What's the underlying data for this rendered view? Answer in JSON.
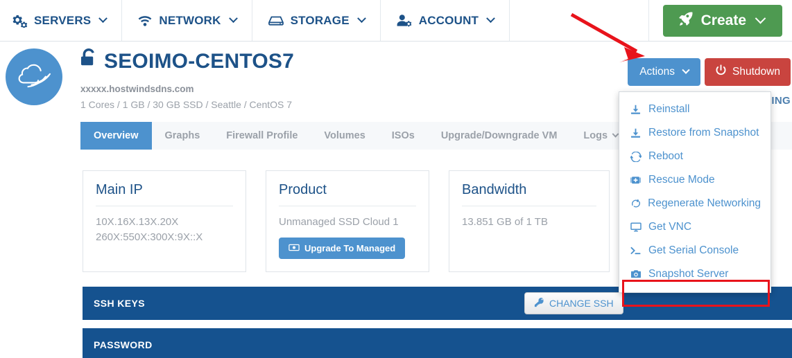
{
  "topnav": {
    "items": [
      {
        "label": "SERVERS",
        "icon": "gears-icon",
        "caret": true
      },
      {
        "label": "NETWORK",
        "icon": "wifi-icon",
        "caret": true
      },
      {
        "label": "STORAGE",
        "icon": "storage-icon",
        "caret": true
      },
      {
        "label": "ACCOUNT",
        "icon": "user-gear-icon",
        "caret": true
      }
    ],
    "create_label": "Create",
    "create_icon": "rocket-icon",
    "create_color": "#4e9a51"
  },
  "header": {
    "avatar_icon": "hostwinds-cloud-logo",
    "avatar_color": "#4d92ce",
    "lock_icon": "unlock-icon",
    "title": "SEOIMO-CENTOS7",
    "hostname": "xxxxx.hostwindsdns.com",
    "specs": "1 Cores / 1 GB / 30 GB SSD / Seattle / CentOS 7",
    "actions_label": "Actions",
    "actions_color": "#4d92ce",
    "shutdown_label": "Shutdown",
    "shutdown_icon": "power-icon",
    "shutdown_color": "#c9443f",
    "billing_partial": "ING"
  },
  "tabs": [
    {
      "label": "Overview",
      "active": true
    },
    {
      "label": "Graphs",
      "active": false
    },
    {
      "label": "Firewall Profile",
      "active": false
    },
    {
      "label": "Volumes",
      "active": false
    },
    {
      "label": "ISOs",
      "active": false
    },
    {
      "label": "Upgrade/Downgrade VM",
      "active": false
    },
    {
      "label": "Logs",
      "active": false,
      "caret": true
    }
  ],
  "cards": {
    "main_ip": {
      "title": "Main IP",
      "ipv4": "10X.16X.13X.20X",
      "ipv6": "260X:550X:300X:9X::X"
    },
    "product": {
      "title": "Product",
      "value": "Unmanaged SSD Cloud 1",
      "button_label": "Upgrade To Managed",
      "button_icon": "money-bill-icon"
    },
    "bandwidth": {
      "title": "Bandwidth",
      "value": "13.851 GB of 1 TB"
    }
  },
  "sections": {
    "ssh_keys": {
      "title": "SSH KEYS",
      "button_label": "CHANGE SSH",
      "button_icon": "key-icon"
    },
    "password": {
      "title": "PASSWORD"
    },
    "bar_color": "#15528f"
  },
  "actions_dropdown": {
    "items": [
      {
        "label": "Reinstall",
        "icon": "download-icon",
        "highlighted": false
      },
      {
        "label": "Restore from Snapshot",
        "icon": "download-icon",
        "highlighted": false
      },
      {
        "label": "Reboot",
        "icon": "refresh-icon",
        "highlighted": false
      },
      {
        "label": "Rescue Mode",
        "icon": "medkit-icon",
        "highlighted": false
      },
      {
        "label": "Regenerate Networking",
        "icon": "recycle-icon",
        "highlighted": false
      },
      {
        "label": "Get VNC",
        "icon": "monitor-icon",
        "highlighted": false
      },
      {
        "label": "Get Serial Console",
        "icon": "terminal-icon",
        "highlighted": false
      },
      {
        "label": "Snapshot Server",
        "icon": "camera-icon",
        "highlighted": true
      }
    ],
    "highlight_color": "#e8131b"
  },
  "annotation": {
    "arrow_color": "#e8131b",
    "arrow_target": "actions-button"
  }
}
